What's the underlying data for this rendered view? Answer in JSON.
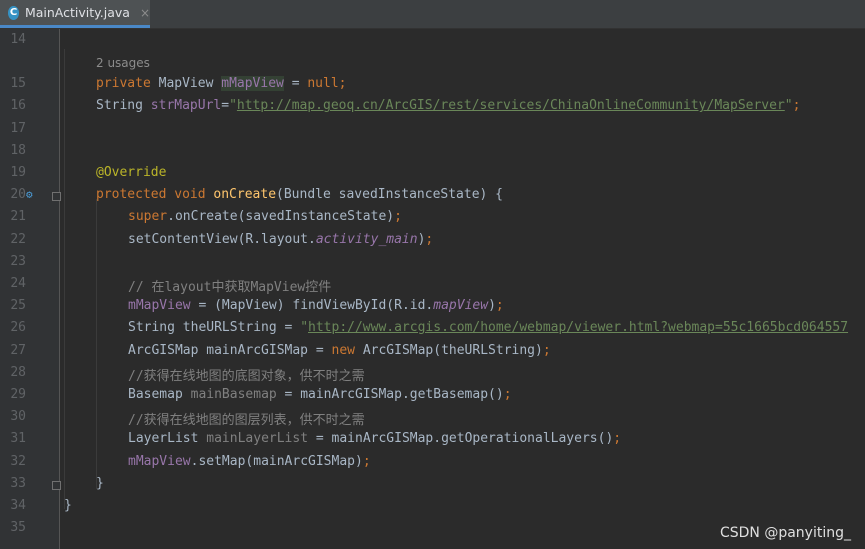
{
  "tab": {
    "label": "MainActivity.java",
    "icon": "class-icon",
    "close": "×"
  },
  "editor": {
    "usages_hint": "2 usages",
    "lines": [
      {
        "n": "14"
      },
      {
        "n": "15",
        "segs": [
          [
            "kw",
            "private "
          ],
          [
            "",
            "MapView "
          ],
          [
            "fld hl",
            "mMapView"
          ],
          [
            "",
            " = "
          ],
          [
            "kw",
            "null;"
          ]
        ]
      },
      {
        "n": "16",
        "segs": [
          [
            "",
            "String "
          ],
          [
            "fld",
            "strMapUrl"
          ],
          [
            "",
            "="
          ],
          [
            "str",
            "\""
          ],
          [
            "link",
            "http://map.geoq.cn/ArcGIS/rest/services/ChinaOnlineCommunity/MapServer"
          ],
          [
            "str",
            "\""
          ],
          [
            "kw",
            ";"
          ]
        ]
      },
      {
        "n": "17"
      },
      {
        "n": "18"
      },
      {
        "n": "19",
        "segs": [
          [
            "ann",
            "@Override"
          ]
        ]
      },
      {
        "n": "20",
        "segs": [
          [
            "kw",
            "protected void "
          ],
          [
            "fn",
            "onCreate"
          ],
          [
            "",
            "(Bundle savedInstanceState) {"
          ]
        ]
      },
      {
        "n": "21",
        "indent": 1,
        "segs": [
          [
            "kw",
            "super"
          ],
          [
            "",
            ".onCreate(savedInstanceState)"
          ],
          [
            "kw",
            ";"
          ]
        ]
      },
      {
        "n": "22",
        "indent": 1,
        "segs": [
          [
            "",
            "setContentView(R.layout."
          ],
          [
            "fld ital",
            "activity_main"
          ],
          [
            "",
            ")"
          ],
          [
            "kw",
            ";"
          ]
        ]
      },
      {
        "n": "23"
      },
      {
        "n": "24",
        "indent": 1,
        "segs": [
          [
            "cmt",
            "// 在layout中获取MapView控件"
          ]
        ]
      },
      {
        "n": "25",
        "indent": 1,
        "segs": [
          [
            "fld",
            "mMapView"
          ],
          [
            "",
            " = (MapView) findViewById(R.id."
          ],
          [
            "fld ital",
            "mapView"
          ],
          [
            "",
            ")"
          ],
          [
            "kw",
            ";"
          ]
        ]
      },
      {
        "n": "26",
        "indent": 1,
        "segs": [
          [
            "",
            "String theURLString = "
          ],
          [
            "str",
            "\""
          ],
          [
            "link",
            "http://www.arcgis.com/home/webmap/viewer.html?webmap=55c1665bcd064557"
          ]
        ]
      },
      {
        "n": "27",
        "indent": 1,
        "segs": [
          [
            "",
            "ArcGISMap mainArcGISMap = "
          ],
          [
            "kw",
            "new "
          ],
          [
            "",
            "ArcGISMap(theURLString)"
          ],
          [
            "kw",
            ";"
          ]
        ]
      },
      {
        "n": "28",
        "indent": 1,
        "segs": [
          [
            "cmt",
            "//获得在线地图的底图对象，供不时之需"
          ]
        ]
      },
      {
        "n": "29",
        "indent": 1,
        "segs": [
          [
            "",
            "Basemap "
          ],
          [
            "cmt",
            "mainBasemap"
          ],
          [
            "",
            " = mainArcGISMap.getBasemap()"
          ],
          [
            "kw",
            ";"
          ]
        ]
      },
      {
        "n": "30",
        "indent": 1,
        "segs": [
          [
            "cmt",
            "//获得在线地图的图层列表，供不时之需"
          ]
        ]
      },
      {
        "n": "31",
        "indent": 1,
        "segs": [
          [
            "",
            "LayerList "
          ],
          [
            "cmt",
            "mainLayerList"
          ],
          [
            "",
            " = mainArcGISMap.getOperationalLayers()"
          ],
          [
            "kw",
            ";"
          ]
        ]
      },
      {
        "n": "32",
        "indent": 1,
        "segs": [
          [
            "fld",
            "mMapView"
          ],
          [
            "",
            ".setMap(mainArcGISMap)"
          ],
          [
            "kw",
            ";"
          ]
        ]
      },
      {
        "n": "33",
        "segs": [
          [
            "",
            "}"
          ]
        ]
      },
      {
        "n": "34",
        "indent": -1,
        "segs": [
          [
            "",
            "}"
          ]
        ]
      },
      {
        "n": "35"
      }
    ]
  },
  "watermark": "CSDN @panyiting_"
}
